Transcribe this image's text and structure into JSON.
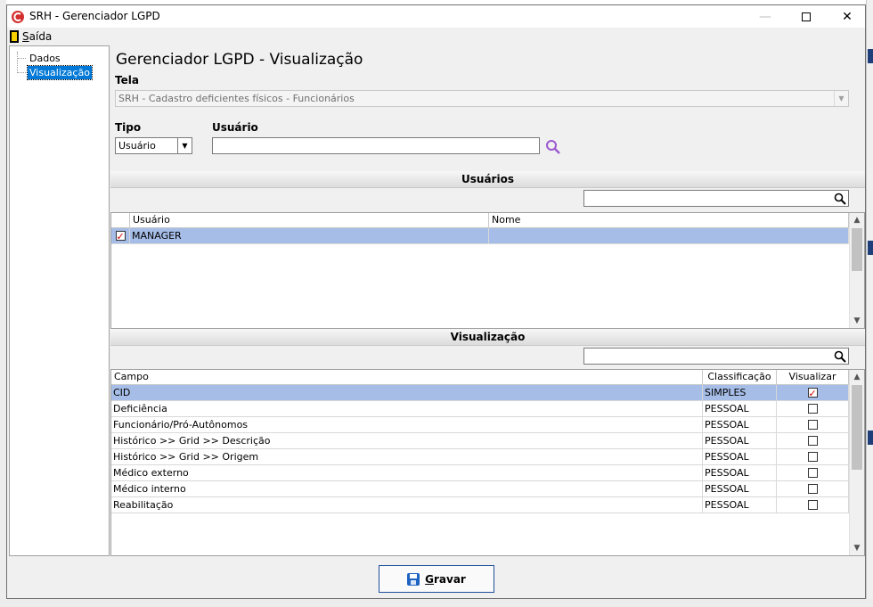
{
  "window": {
    "title": "SRH - Gerenciador LGPD",
    "minimize_glyph": "—",
    "close_glyph": "✕"
  },
  "menu": {
    "exit_prefix": "S",
    "exit_rest": "aída",
    "exit_icon": "door-exit-icon"
  },
  "tree": {
    "items": [
      {
        "label": "Dados",
        "selected": false
      },
      {
        "label": "Visualização",
        "selected": true
      }
    ]
  },
  "page": {
    "title": "Gerenciador LGPD - Visualização",
    "tela_label": "Tela",
    "tela_value": "SRH - Cadastro deficientes físicos - Funcionários",
    "tipo_label": "Tipo",
    "tipo_value": "Usuário",
    "usuario_label": "Usuário",
    "usuario_value": ""
  },
  "users_section": {
    "title": "Usuários",
    "filter_value": "",
    "columns": [
      "Usuário",
      "Nome"
    ],
    "rows": [
      {
        "checked": true,
        "usuario": "MANAGER",
        "nome": ""
      }
    ]
  },
  "view_section": {
    "title": "Visualização",
    "filter_value": "",
    "columns": [
      "Campo",
      "Classificação",
      "Visualizar"
    ],
    "rows": [
      {
        "campo": "CID",
        "classificacao": "SIMPLES",
        "visualizar": true
      },
      {
        "campo": "Deficiência",
        "classificacao": "PESSOAL",
        "visualizar": false
      },
      {
        "campo": "Funcionário/Pró-Autônomos",
        "classificacao": "PESSOAL",
        "visualizar": false
      },
      {
        "campo": "Histórico >> Grid >> Descrição",
        "classificacao": "PESSOAL",
        "visualizar": false
      },
      {
        "campo": "Histórico >> Grid >> Origem",
        "classificacao": "PESSOAL",
        "visualizar": false
      },
      {
        "campo": "Médico externo",
        "classificacao": "PESSOAL",
        "visualizar": false
      },
      {
        "campo": "Médico interno",
        "classificacao": "PESSOAL",
        "visualizar": false
      },
      {
        "campo": "Reabilitação",
        "classificacao": "PESSOAL",
        "visualizar": false
      }
    ]
  },
  "footer": {
    "save_prefix": "G",
    "save_rest": "ravar"
  },
  "colors": {
    "selection": "#a6bde7",
    "tree_selection": "#0078d7",
    "check_mark": "#d40000",
    "accent_search": "#9b59d0"
  }
}
